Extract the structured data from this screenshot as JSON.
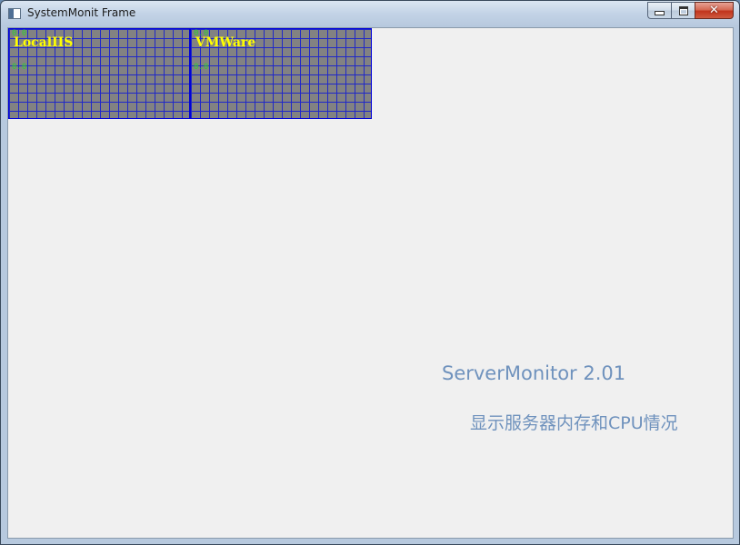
{
  "window": {
    "title": "SystemMonit Frame",
    "controls": {
      "minimize_icon": "minimize-icon",
      "maximize_icon": "maximize-icon",
      "close_icon": "close-icon",
      "close_glyph": "✕"
    }
  },
  "monitors": [
    {
      "name": "LocalIIS",
      "top_value": "0.0",
      "mid_value": "0.0"
    },
    {
      "name": "VMWare",
      "top_value": "0.0",
      "mid_value": "0.0"
    }
  ],
  "about": {
    "app_name": "ServerMonitor 2.01",
    "description": "显示服务器内存和CPU情况"
  },
  "colors": {
    "panel_background": "#828282",
    "grid_lines": "#2028c8",
    "label": "#ffff00",
    "value": "#30d030",
    "about_text": "#6f92bd"
  }
}
